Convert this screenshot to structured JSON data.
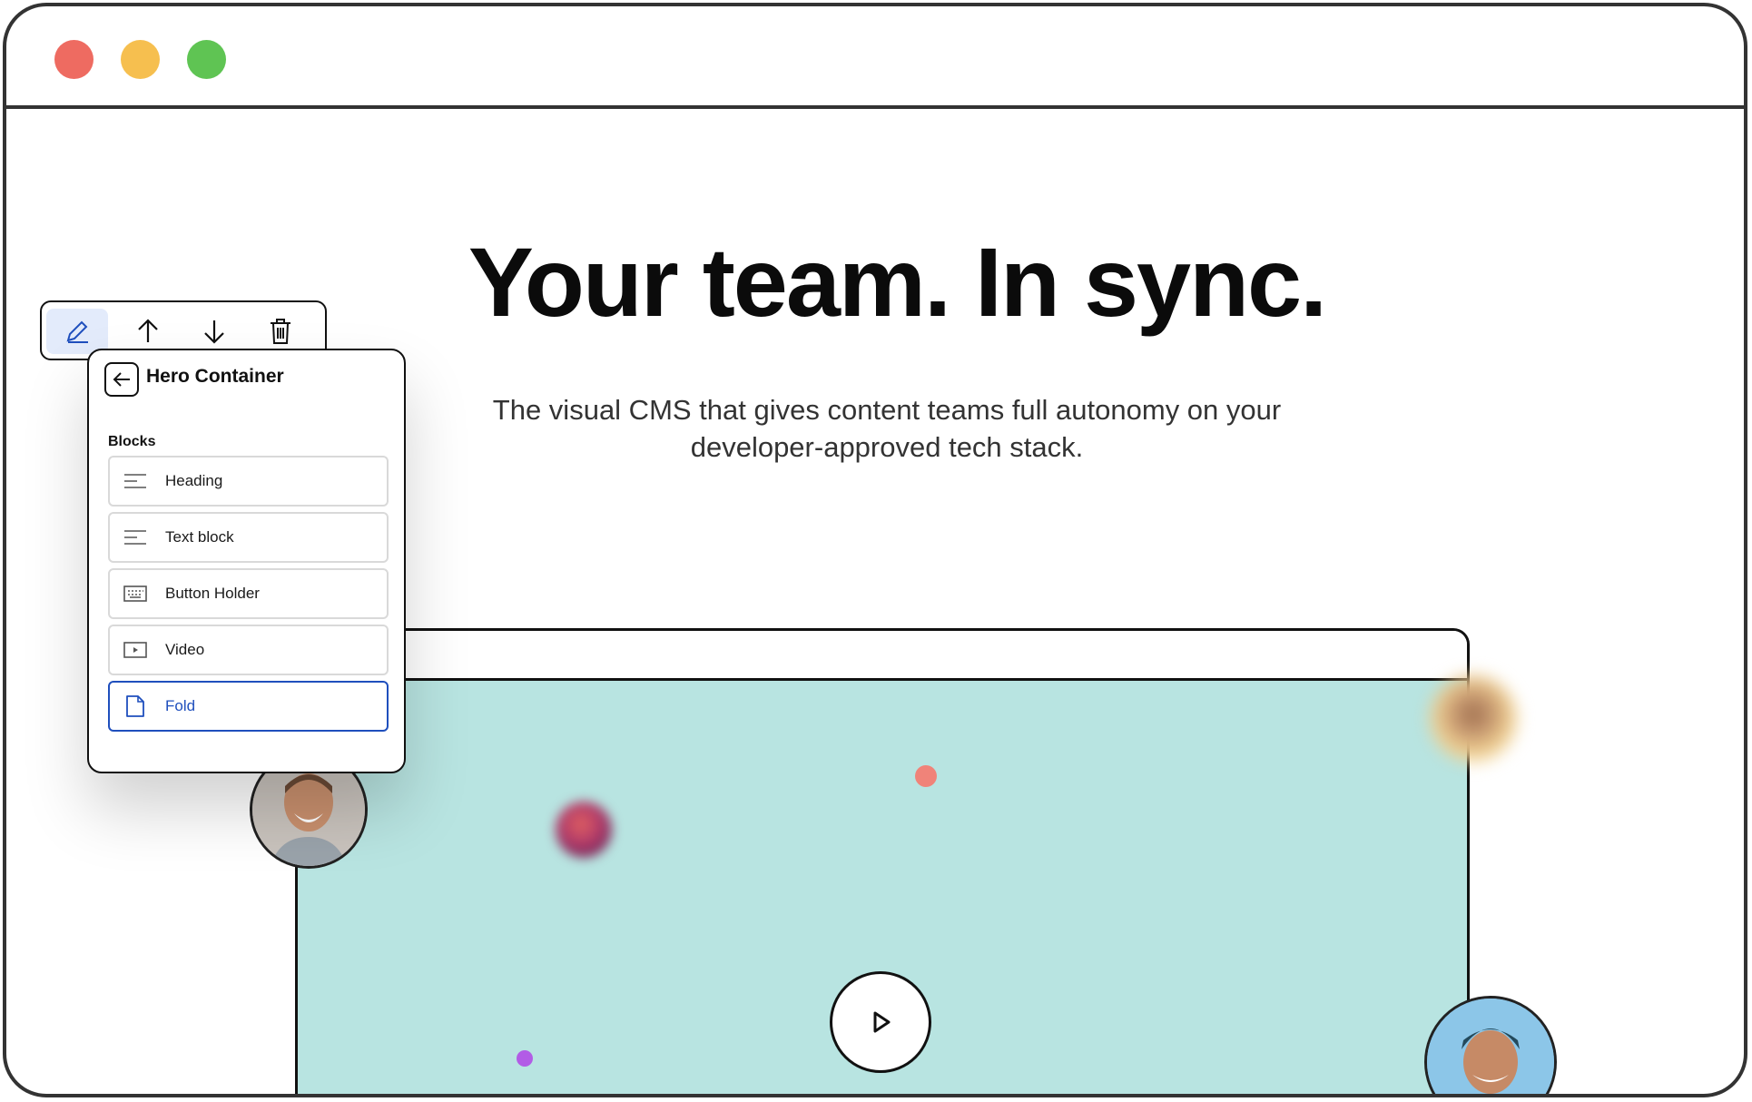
{
  "window": {
    "controls": [
      "close",
      "minimize",
      "maximize"
    ]
  },
  "hero": {
    "title": "Your team. In sync.",
    "subtitle": "The visual CMS that gives content teams full autonomy on your developer-approved tech stack."
  },
  "toolbar": {
    "tools": [
      {
        "icon": "pencil-icon",
        "active": true
      },
      {
        "icon": "arrow-up-icon",
        "active": false
      },
      {
        "icon": "arrow-down-icon",
        "active": false
      },
      {
        "icon": "trash-icon",
        "active": false
      }
    ]
  },
  "panel": {
    "title": "Hero Container",
    "section_label": "Blocks",
    "items": [
      {
        "label": "Heading",
        "icon": "lines-icon"
      },
      {
        "label": "Text block",
        "icon": "lines-icon"
      },
      {
        "label": "Button Holder",
        "icon": "keyboard-icon"
      },
      {
        "label": "Video",
        "icon": "video-icon"
      },
      {
        "label": "Fold",
        "icon": "document-icon",
        "selected": true
      }
    ]
  },
  "colors": {
    "accent": "#1f4fbd",
    "screen": "#b8e4e1",
    "close": "#ee6b61",
    "minimize": "#f6bf4f",
    "maximize": "#5fc453"
  }
}
